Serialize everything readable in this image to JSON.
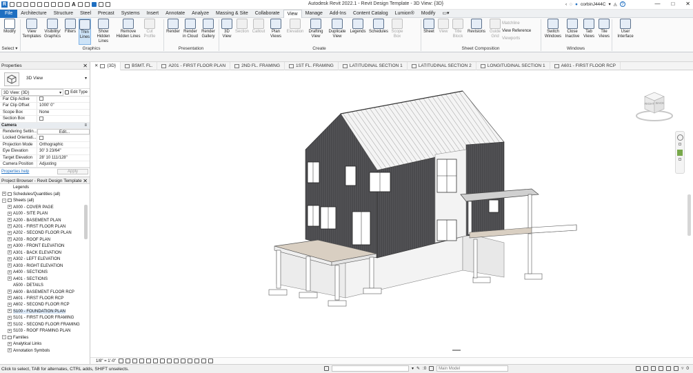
{
  "title_bar": {
    "title": "Autodesk Revit 2022.1 - Revit Design Template - 3D View: {3D}",
    "user": "corbinJ444C",
    "help": "?"
  },
  "menu_tabs": [
    "File",
    "Architecture",
    "Structure",
    "Steel",
    "Precast",
    "Systems",
    "Insert",
    "Annotate",
    "Analyze",
    "Massing & Site",
    "Collaborate",
    "View",
    "Manage",
    "Add-Ins",
    "Content Catalog",
    "Lumion®",
    "Modify"
  ],
  "active_menu_tab": "View",
  "ribbon": {
    "select": {
      "modify": "Modify",
      "select_label": "Select ▾"
    },
    "graphics": {
      "label": "Graphics",
      "buttons": [
        {
          "line1": "View",
          "line2": "Templates"
        },
        {
          "line1": "Visibility/",
          "line2": "Graphics"
        },
        {
          "line1": "Filters",
          "line2": ""
        },
        {
          "line1": "Thin",
          "line2": "Lines"
        },
        {
          "line1": "Show",
          "line2": "Hidden Lines"
        },
        {
          "line1": "Remove",
          "line2": "Hidden Lines"
        },
        {
          "line1": "Cut",
          "line2": "Profile"
        }
      ]
    },
    "presentation": {
      "label": "Presentation",
      "buttons": [
        {
          "line1": "Render",
          "line2": ""
        },
        {
          "line1": "Render",
          "line2": "in Cloud"
        },
        {
          "line1": "Render",
          "line2": "Gallery"
        }
      ]
    },
    "create": {
      "label": "Create",
      "buttons": [
        {
          "line1": "3D",
          "line2": "View"
        },
        {
          "line1": "Section",
          "line2": ""
        },
        {
          "line1": "Callout",
          "line2": ""
        },
        {
          "line1": "Plan",
          "line2": "Views"
        },
        {
          "line1": "Elevation",
          "line2": ""
        },
        {
          "line1": "Drafting",
          "line2": "View"
        },
        {
          "line1": "Duplicate",
          "line2": "View"
        },
        {
          "line1": "Legends",
          "line2": ""
        },
        {
          "line1": "Schedules",
          "line2": ""
        },
        {
          "line1": "Scope",
          "line2": "Box"
        }
      ]
    },
    "sheet_composition": {
      "label": "Sheet Composition",
      "buttons": [
        {
          "line1": "Sheet",
          "line2": ""
        },
        {
          "line1": "View",
          "line2": ""
        },
        {
          "line1": "Title",
          "line2": "Block"
        },
        {
          "line1": "Revisions",
          "line2": ""
        },
        {
          "line1": "Guide",
          "line2": "Grid"
        }
      ],
      "small": [
        "Matchline",
        "View Reference",
        "Viewports"
      ]
    },
    "windows": {
      "label": "Windows",
      "buttons": [
        {
          "line1": "Switch",
          "line2": "Windows"
        },
        {
          "line1": "Close",
          "line2": "Inactive"
        },
        {
          "line1": "Tab",
          "line2": "Views"
        },
        {
          "line1": "Tile",
          "line2": "Views"
        }
      ]
    },
    "user_interface": {
      "line1": "User",
      "line2": "Interface"
    }
  },
  "doc_tabs": [
    "{3D}",
    "BSMT. FL.",
    "A201 - FIRST FLOOR PLAN",
    "2ND FL. FRAMING",
    "1ST FL. FRAMING",
    "LATITUDINAL SECTION 1",
    "LATITUDINAL SECTION 2",
    "LONGITUDINAL SECTION 1",
    "A601 - FIRST FLOOR RCP"
  ],
  "properties": {
    "header": "Properties",
    "type_name": "3D View",
    "selector": "3D View: {3D}",
    "edit_type": "Edit Type",
    "rows": [
      {
        "k": "Far Clip Active",
        "v": ""
      },
      {
        "k": "Far Clip Offset",
        "v": "1000'  0\""
      },
      {
        "k": "Scope Box",
        "v": "None"
      },
      {
        "k": "Section Box",
        "v": ""
      }
    ],
    "camera_label": "Camera",
    "camera_rows": [
      {
        "k": "Rendering Settin...",
        "v": "Edit..."
      },
      {
        "k": "Locked Orientati...",
        "v": ""
      },
      {
        "k": "Projection Mode",
        "v": "Orthographic"
      },
      {
        "k": "Eye Elevation",
        "v": "30'  3 23/64\""
      },
      {
        "k": "Target Elevation",
        "v": "28'  10 111/128\""
      },
      {
        "k": "Camera Position",
        "v": "Adjusting"
      }
    ],
    "help": "Properties help",
    "apply": "Apply"
  },
  "browser": {
    "header": "Project Browser - Revit Design Template",
    "items": [
      {
        "label": "Legends",
        "indent": 1,
        "exp": ""
      },
      {
        "label": "Schedules/Quantities (all)",
        "indent": 0,
        "exp": "+"
      },
      {
        "label": "Sheets (all)",
        "indent": 0,
        "exp": "−"
      },
      {
        "label": "A000 - COVER PAGE",
        "indent": 1,
        "exp": "+"
      },
      {
        "label": "A100 - SITE PLAN",
        "indent": 1,
        "exp": "+"
      },
      {
        "label": "A200 - BASEMENT PLAN",
        "indent": 1,
        "exp": "+"
      },
      {
        "label": "A201 - FIRST FLOOR PLAN",
        "indent": 1,
        "exp": "+"
      },
      {
        "label": "A202 - SECOND FLOOR PLAN",
        "indent": 1,
        "exp": "+"
      },
      {
        "label": "A203 - ROOF PLAN",
        "indent": 1,
        "exp": "+"
      },
      {
        "label": "A300 - FRONT ELEVATION",
        "indent": 1,
        "exp": "+"
      },
      {
        "label": "A301 - BACK ELEVATION",
        "indent": 1,
        "exp": "+"
      },
      {
        "label": "A302 - LEFT ELEVATION",
        "indent": 1,
        "exp": "+"
      },
      {
        "label": "A303 - RIGHT ELEVATION",
        "indent": 1,
        "exp": "+"
      },
      {
        "label": "A400 - SECTIONS",
        "indent": 1,
        "exp": "+"
      },
      {
        "label": "A401 - SECTIONS",
        "indent": 1,
        "exp": "+"
      },
      {
        "label": "A500 - DETAILS",
        "indent": 1,
        "exp": ""
      },
      {
        "label": "A600 - BASEMENT FLOOR RCP",
        "indent": 1,
        "exp": "+"
      },
      {
        "label": "A601 - FIRST FLOOR RCP",
        "indent": 1,
        "exp": "+"
      },
      {
        "label": "A602 - SECOND FLOOR RCP",
        "indent": 1,
        "exp": "+"
      },
      {
        "label": "S100 - FOUNDATION PLAN",
        "indent": 1,
        "exp": "+",
        "selected": true
      },
      {
        "label": "S101 - FIRST FLOOR FRAMING",
        "indent": 1,
        "exp": "+"
      },
      {
        "label": "S102 - SECOND FLOOR FRAMING",
        "indent": 1,
        "exp": "+"
      },
      {
        "label": "S103 - ROOF FRAMING PLAN",
        "indent": 1,
        "exp": "+"
      },
      {
        "label": "Families",
        "indent": 0,
        "exp": "−"
      },
      {
        "label": "Analytical Links",
        "indent": 1,
        "exp": "+"
      },
      {
        "label": "Annotation Symbols",
        "indent": 1,
        "exp": "+"
      }
    ]
  },
  "viewcube": {
    "left": "RIGHT",
    "right": "BACK"
  },
  "view_control": {
    "scale": "1/8\" = 1'-0\""
  },
  "status": {
    "text": "Click to select, TAB for alternates, CTRL adds, SHIFT unselects.",
    "model": "Main Model",
    "zero": ":0",
    "filter": "0"
  },
  "colors": {
    "file_tab": "#1f6fc1",
    "wall": "#4a4a4d",
    "roof": "#f2f2f2",
    "deck": "#d9cfc2"
  }
}
